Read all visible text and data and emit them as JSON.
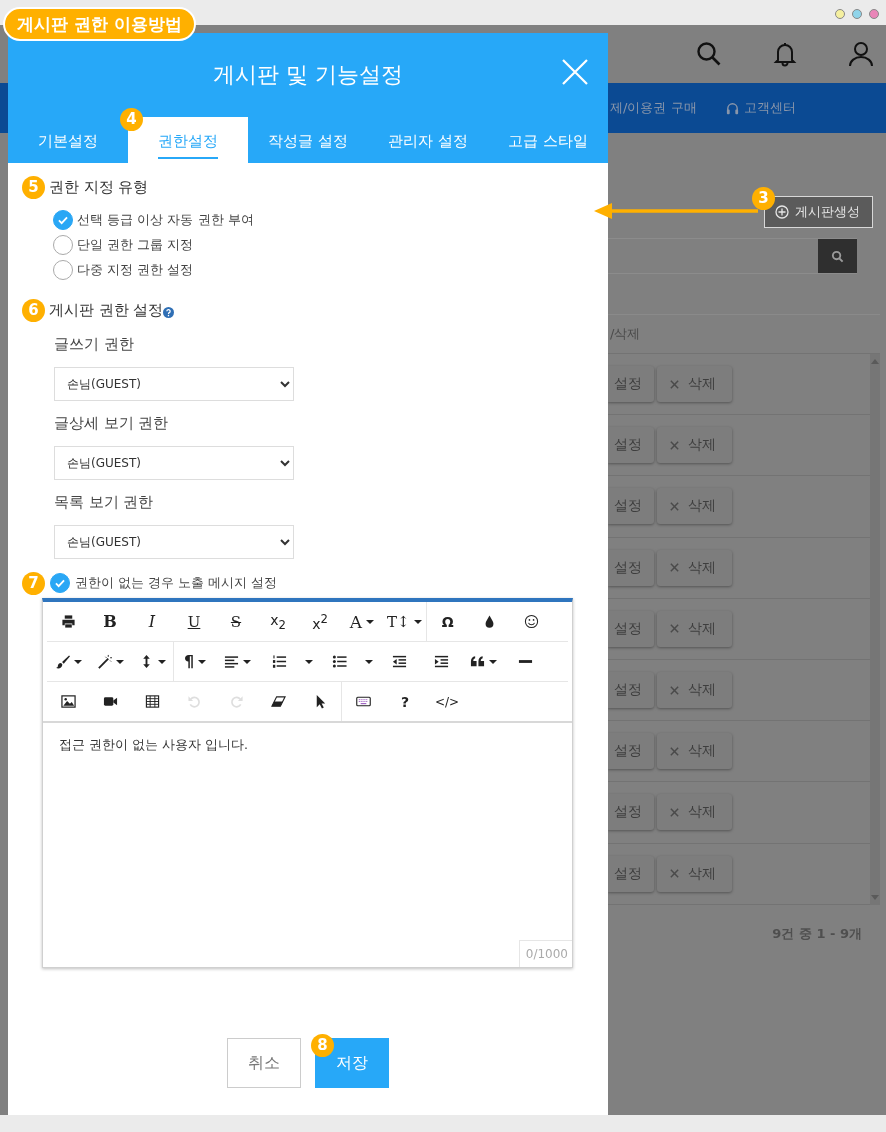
{
  "guide_title": "게시판 권한 이용방법",
  "site": {
    "nav": [
      {
        "kind": "text",
        "label": "제/이용권 구매"
      },
      {
        "kind": "support",
        "label": "고객센터"
      }
    ],
    "create_button": {
      "label": "게시판생성",
      "step": "3"
    },
    "table": {
      "column_header": "/삭제",
      "rows": [
        {
          "edit": "설정",
          "delete": "삭제"
        },
        {
          "edit": "설정",
          "delete": "삭제"
        },
        {
          "edit": "설정",
          "delete": "삭제"
        },
        {
          "edit": "설정",
          "delete": "삭제"
        },
        {
          "edit": "설정",
          "delete": "삭제"
        },
        {
          "edit": "설정",
          "delete": "삭제"
        },
        {
          "edit": "설정",
          "delete": "삭제"
        },
        {
          "edit": "설정",
          "delete": "삭제"
        },
        {
          "edit": "설정",
          "delete": "삭제"
        }
      ]
    },
    "pagination": "9건 중 1 - 9개"
  },
  "dialog": {
    "title": "게시판 및 기능설정",
    "tabs": [
      {
        "label": "기본설정",
        "selected": false
      },
      {
        "label": "권한설정",
        "selected": true,
        "step": "4"
      },
      {
        "label": "작성글 설정",
        "selected": false
      },
      {
        "label": "관리자 설정",
        "selected": false
      },
      {
        "label": "고급 스타일",
        "selected": false
      }
    ],
    "permission_type": {
      "step": "5",
      "title": "권한 지정 유형",
      "options": [
        {
          "label": "선택 등급 이상 자동 권한 부여",
          "selected": true
        },
        {
          "label": "단일 권한 그룹 지정",
          "selected": false
        },
        {
          "label": "다중 지정 권한 설정",
          "selected": false
        }
      ]
    },
    "board_permissions": {
      "step": "6",
      "title": "게시판 권한 설정",
      "fields": [
        {
          "label": "글쓰기 권한",
          "value": "손님(GUEST)"
        },
        {
          "label": "글상세 보기 권한",
          "value": "손님(GUEST)"
        },
        {
          "label": "목록 보기 권한",
          "value": "손님(GUEST)"
        }
      ]
    },
    "notice": {
      "step": "7",
      "label": "권한이 없는 경우 노출 메시지 설정",
      "checked": true
    },
    "editor": {
      "toolbar": [
        [
          [
            {
              "kind": "print",
              "disabled": false
            },
            {
              "kind": "bold",
              "glyph": "B",
              "disabled": false
            },
            {
              "kind": "italic",
              "glyph": "I",
              "disabled": false
            },
            {
              "kind": "underline",
              "glyph": "U",
              "disabled": false
            },
            {
              "kind": "strike",
              "glyph": "S",
              "disabled": false
            },
            {
              "kind": "subscript",
              "glyph": "x$_{2}$",
              "disabled": false
            },
            {
              "kind": "superscript",
              "glyph": "x$^{2}$",
              "disabled": false
            },
            {
              "kind": "fontcolor",
              "glyph": "A",
              "disabled": false
            },
            {
              "kind": "fontsize",
              "glyph": "T↕",
              "disabled": false
            }
          ],
          [
            {
              "kind": "special",
              "glyph": "Ω",
              "disabled": false
            },
            {
              "kind": "drop",
              "disabled": false
            },
            {
              "kind": "emoji",
              "disabled": false
            }
          ]
        ],
        [
          [
            {
              "kind": "brush",
              "disabled": false
            },
            {
              "kind": "magic",
              "disabled": false
            },
            {
              "kind": "lineheight",
              "disabled": false
            }
          ],
          [
            {
              "kind": "paragraph",
              "glyph": "¶",
              "disabled": false
            },
            {
              "kind": "align",
              "disabled": false
            },
            {
              "kind": "ol",
              "disabled": false
            },
            {
              "kind": "ul",
              "disabled": false
            },
            {
              "kind": "outdent",
              "disabled": false
            },
            {
              "kind": "indent",
              "disabled": false
            },
            {
              "kind": "quote",
              "disabled": false
            },
            {
              "kind": "hr",
              "disabled": false
            }
          ]
        ],
        [
          [
            {
              "kind": "image",
              "disabled": false
            },
            {
              "kind": "video",
              "disabled": false
            },
            {
              "kind": "table",
              "disabled": false
            },
            {
              "kind": "undo",
              "disabled": true
            },
            {
              "kind": "redo",
              "disabled": true
            },
            {
              "kind": "eraser",
              "disabled": false
            },
            {
              "kind": "cursor",
              "disabled": false
            }
          ],
          [
            {
              "kind": "keyboard",
              "disabled": false
            },
            {
              "kind": "help",
              "glyph": "?",
              "disabled": false
            },
            {
              "kind": "code",
              "glyph": "</>",
              "disabled": false
            }
          ]
        ]
      ],
      "content": "접근 권한이 없는 사용자 입니다.",
      "counter": "0/1000"
    },
    "buttons": [
      {
        "kind": "cancel",
        "label": "취소"
      },
      {
        "kind": "save",
        "label": "저장",
        "step": "8"
      }
    ]
  }
}
